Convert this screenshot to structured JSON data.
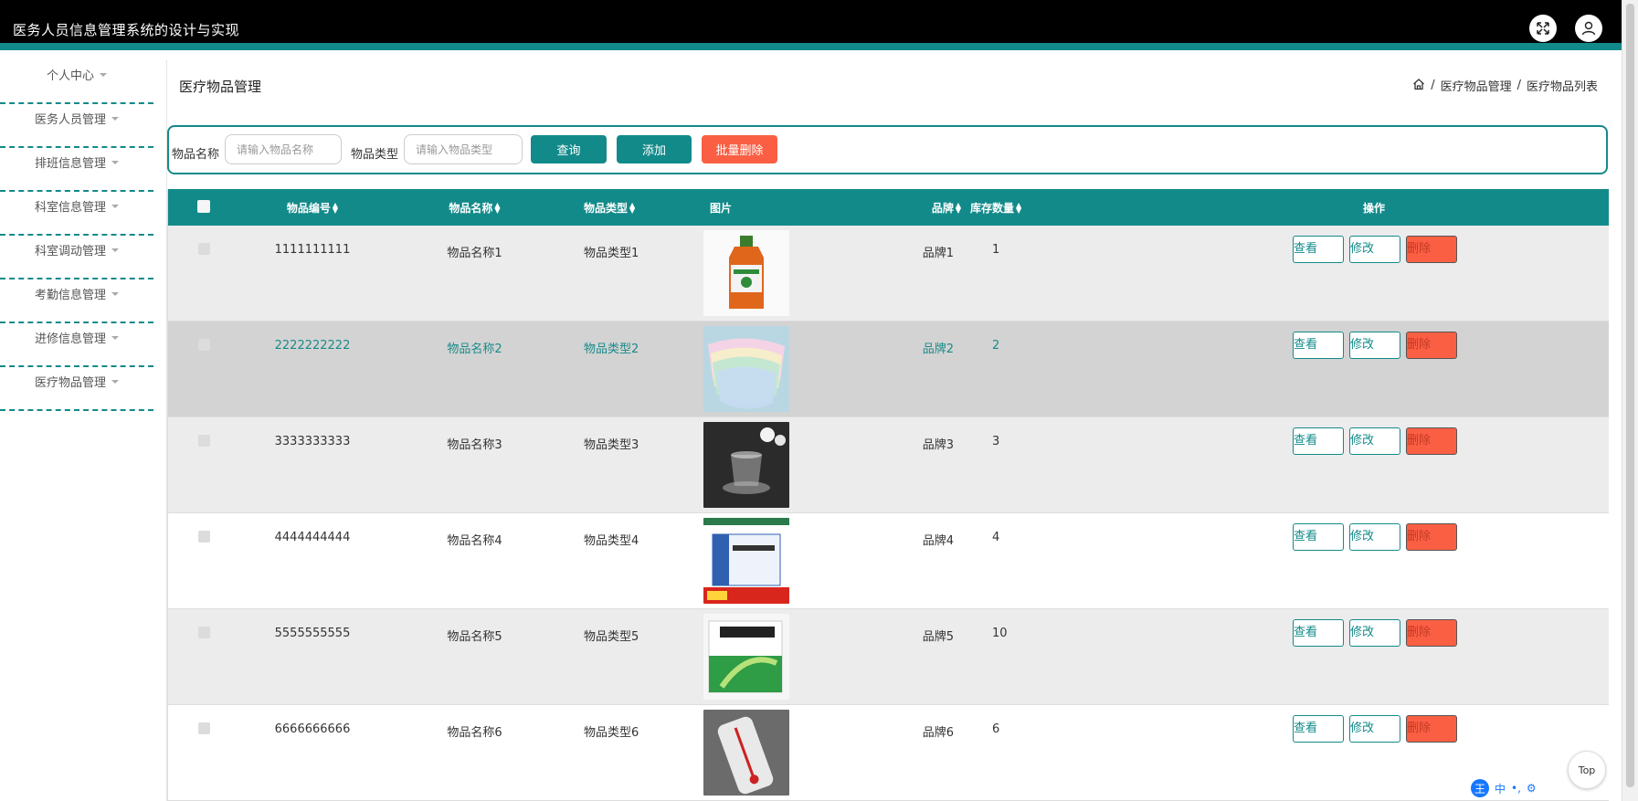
{
  "app": {
    "title": "医务人员信息管理系统的设计与实现"
  },
  "sidebar": {
    "items": [
      {
        "label": "个人中心"
      },
      {
        "label": "医务人员管理"
      },
      {
        "label": "排班信息管理"
      },
      {
        "label": "科室信息管理"
      },
      {
        "label": "科室调动管理"
      },
      {
        "label": "考勤信息管理"
      },
      {
        "label": "进修信息管理"
      },
      {
        "label": "医疗物品管理"
      }
    ]
  },
  "page": {
    "title": "医疗物品管理",
    "breadcrumb": [
      "医疗物品管理",
      "医疗物品列表"
    ]
  },
  "search": {
    "name_label": "物品名称",
    "name_placeholder": "请输入物品名称",
    "type_label": "物品类型",
    "type_placeholder": "请输入物品类型",
    "query_label": "查询",
    "add_label": "添加",
    "batch_delete_label": "批量删除"
  },
  "table": {
    "headers": [
      "物品编号",
      "物品名称",
      "物品类型",
      "图片",
      "品牌",
      "库存数量",
      "操作"
    ],
    "rows": [
      {
        "code": "1111111111",
        "name": "物品名称1",
        "type": "物品类型1",
        "brand": "品牌1",
        "stock": "1",
        "image": "disinfectant-bottle"
      },
      {
        "code": "2222222222",
        "name": "物品名称2",
        "type": "物品类型2",
        "brand": "品牌2",
        "stock": "2",
        "image": "face-masks"
      },
      {
        "code": "3333333333",
        "name": "物品名称3",
        "type": "物品类型3",
        "brand": "品牌3",
        "stock": "3",
        "image": "glass-cup"
      },
      {
        "code": "4444444444",
        "name": "物品名称4",
        "type": "物品类型4",
        "brand": "品牌4",
        "stock": "4",
        "image": "medicine-box-blue"
      },
      {
        "code": "5555555555",
        "name": "物品名称5",
        "type": "物品类型5",
        "brand": "品牌5",
        "stock": "10",
        "image": "medicine-box-green"
      },
      {
        "code": "6666666666",
        "name": "物品名称6",
        "type": "物品类型6",
        "brand": "品牌6",
        "stock": "6",
        "image": "thermometer"
      }
    ],
    "actions": {
      "view": "查看",
      "edit": "修改",
      "delete": "删除"
    }
  },
  "footer": {
    "top_label": "Top",
    "ime_label": "中",
    "ime_badge": "王"
  },
  "colors": {
    "accent": "#138a8a",
    "danger": "#fa5f44",
    "topbar": "#000000"
  }
}
